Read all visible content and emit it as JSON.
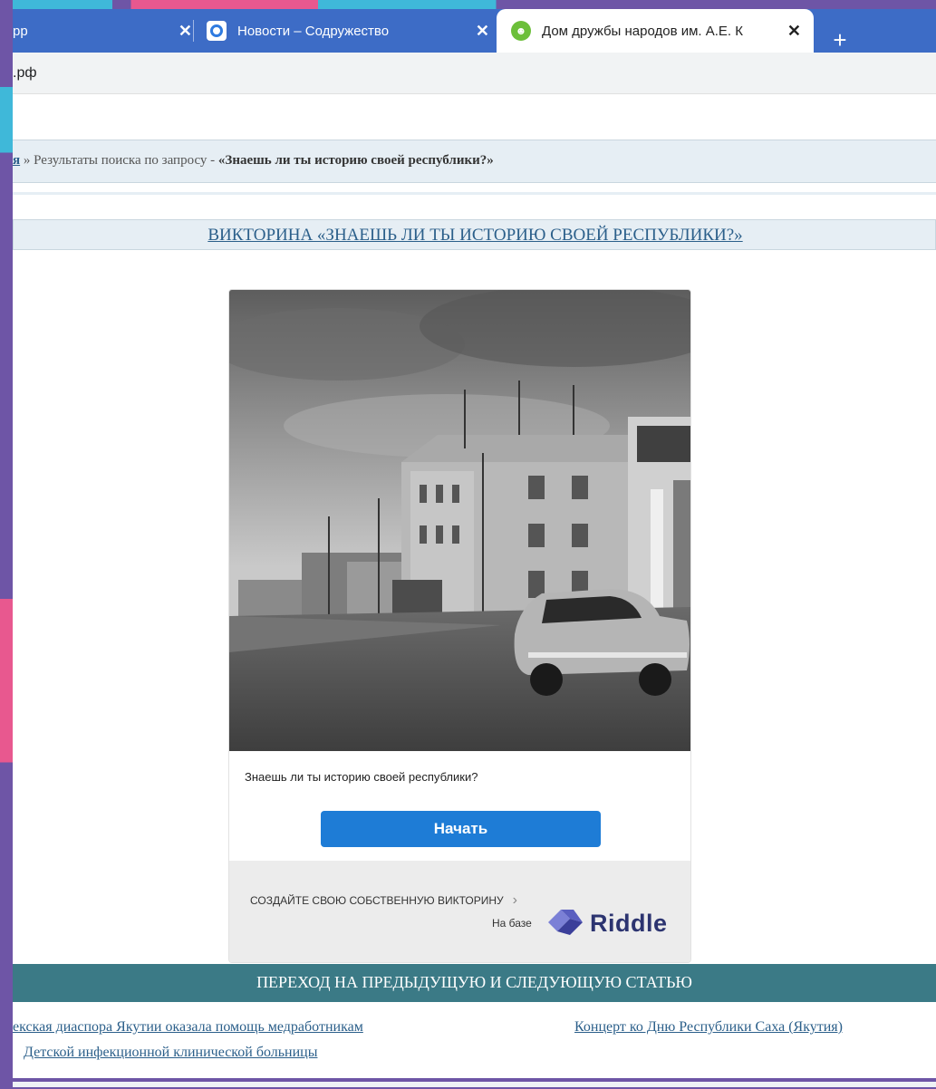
{
  "browser": {
    "tabs": [
      {
        "title": "рр",
        "active": false
      },
      {
        "title": "Новости – Содружество",
        "active": false
      },
      {
        "title": "Дом дружбы народов им. А.Е. К",
        "active": true
      }
    ],
    "close_glyph": "✕",
    "new_tab_glyph": "+",
    "address": ".рф"
  },
  "breadcrumb": {
    "link": "я",
    "separator": " » ",
    "prefix": "Результаты поиска по запросу - ",
    "query": "«Знаешь ли ты историю своей республики?»"
  },
  "article": {
    "title": "ВИКТОРИНА «ЗНАЕШЬ ЛИ ТЫ ИСТОРИЮ СВОЕЙ РЕСПУБЛИКИ?»"
  },
  "quiz": {
    "question": "Знаешь ли ты историю своей республики?",
    "start_label": "Начать",
    "create_label": "СОЗДАЙТЕ СВОЮ СОБСТВЕННУЮ ВИКТОРИНУ",
    "create_chevron": "›",
    "powered_label": "На базе",
    "brand": "Riddle"
  },
  "navigation": {
    "title": "ПЕРЕХОД НА ПРЕДЫДУЩУЮ И СЛЕДУЮЩУЮ СТАТЬЮ",
    "prev_line1": "екская диаспора Якутии оказала помощь медработникам",
    "prev_line2": "Детской инфекционной клинической больницы",
    "next": "Концерт ко Дню Республики Саха (Якутия)"
  },
  "colors": {
    "tabstrip": "#3d6cc6",
    "link": "#2b5f8a",
    "start_button": "#1e7cd6",
    "nav_bar": "#3b7a86",
    "brand": "#2c3470"
  },
  "icons": {
    "tab2_favicon": "news-favicon-icon",
    "tab3_favicon": "house-of-friendship-favicon-icon",
    "brand_logo": "riddle-logo-icon"
  }
}
